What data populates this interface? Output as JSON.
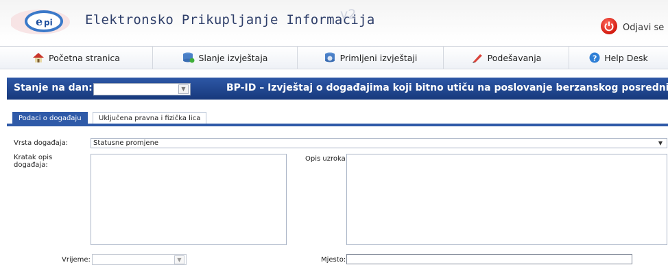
{
  "header": {
    "title": "Elektronsko Prikupljanje Informacija",
    "version": "v2",
    "logout_label": "Odjavi se"
  },
  "nav": {
    "items": [
      {
        "label": "Početna stranica",
        "icon": "home-icon"
      },
      {
        "label": "Slanje izvještaja",
        "icon": "send-database-icon"
      },
      {
        "label": "Primljeni izvještaji",
        "icon": "received-database-icon"
      },
      {
        "label": "Podešavanja",
        "icon": "settings-pencil-icon"
      },
      {
        "label": "Help Desk",
        "icon": "help-icon"
      }
    ]
  },
  "titlebar": {
    "state_label": "Stanje na dan:",
    "report_title": "BP-ID – Izvještaj o događajima koji bitno utiču na poslovanje berzanskog posrednika"
  },
  "tabs": [
    {
      "label": "Podaci o događaju",
      "active": true
    },
    {
      "label": "Uključena pravna i fizička lica",
      "active": false
    }
  ],
  "form": {
    "event_type_label": "Vrsta događaja:",
    "event_type_value": "Statusne promjene",
    "short_desc_label": "Kratak opis događaja:",
    "cause_label": "Opis uzroka:",
    "time_label": "Vrijeme:",
    "place_label": "Mjesto:"
  },
  "colors": {
    "title_bar": "#1f4390",
    "tab_active": "#2f5aa8",
    "power_button": "#d31b10"
  }
}
